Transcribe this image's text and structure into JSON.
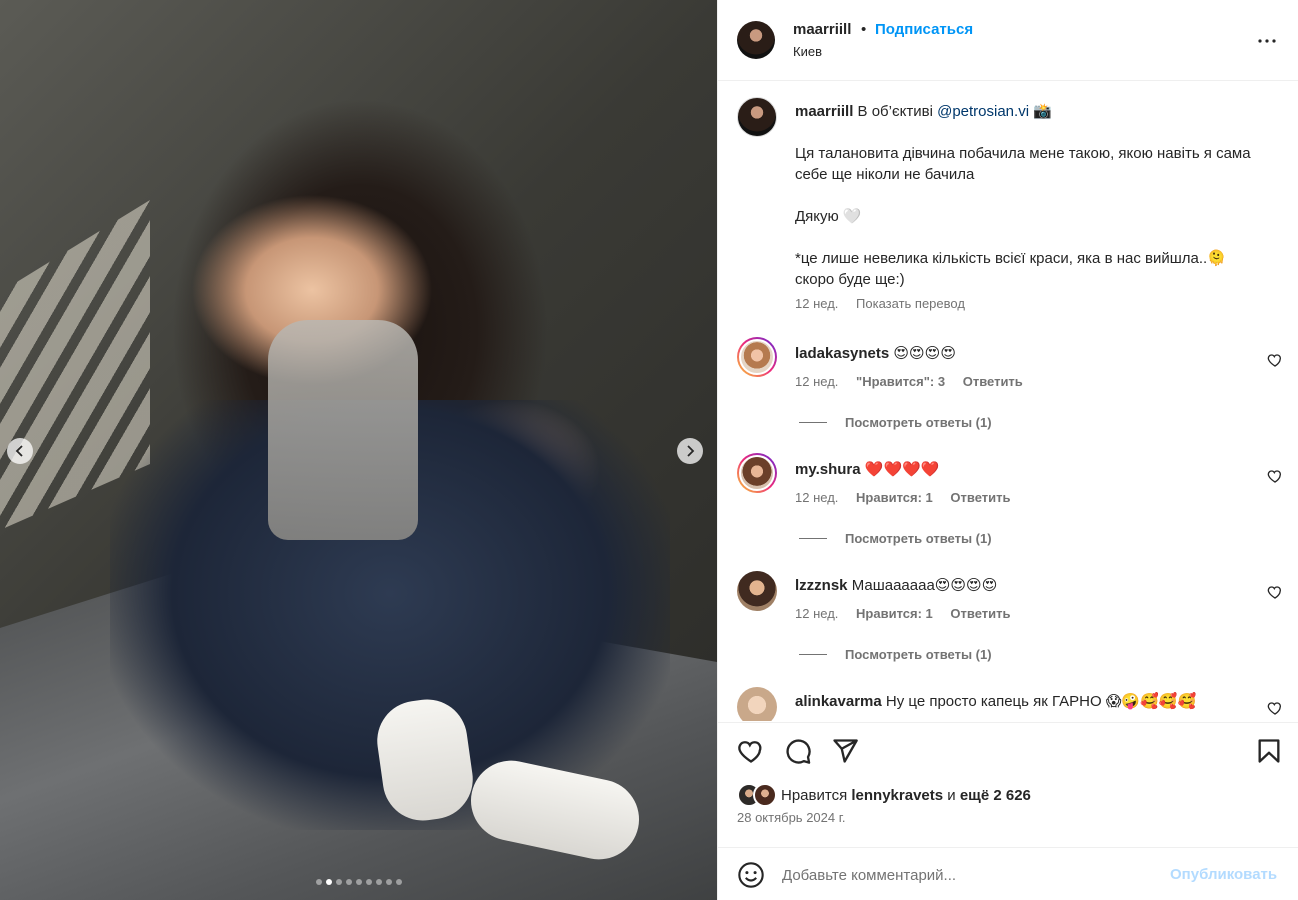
{
  "post": {
    "author": "maarriill",
    "follow_label": "Подписаться",
    "separator": "•",
    "location": "Киев"
  },
  "caption": {
    "author": "maarriill",
    "intro": "В об’єктиві",
    "mention": "@petrosian.vi",
    "camera_emoji": "📸",
    "line1": "Ця талановита дівчина побачила мене такою, якою навіть я сама себе ще ніколи не бачила",
    "line2": "Дякую 🤍",
    "line3": "*це лише невелика кількість всієї краси, яка в нас вийшла..🫠 скоро буде ще:)",
    "age": "12 нед.",
    "translate_label": "Показать перевод"
  },
  "comments": [
    {
      "user": "ladakasynets",
      "text": "😍😍😍😍",
      "age": "12 нед.",
      "likes": "\"Нравится\": 3",
      "reply": "Ответить",
      "view_replies": "Посмотреть ответы (1)"
    },
    {
      "user": "my.shura",
      "text": "❤️❤️❤️❤️",
      "age": "12 нед.",
      "likes": "Нравится: 1",
      "reply": "Ответить",
      "view_replies": "Посмотреть ответы (1)"
    },
    {
      "user": "lzzznsk",
      "text": "Машаааааа😍😍😍😍",
      "age": "12 нед.",
      "likes": "Нравится: 1",
      "reply": "Ответить",
      "view_replies": "Посмотреть ответы (1)"
    },
    {
      "user": "alinkavarma",
      "text": "Ну це просто капець як ГАРНО 😱🤪🥰🥰🥰"
    }
  ],
  "likes": {
    "prefix": "Нравится",
    "user": "lennykravets",
    "and": "и",
    "rest": "ещё 2 626"
  },
  "date": "28 октябрь 2024 г.",
  "composer": {
    "placeholder": "Добавьте комментарий...",
    "publish_label": "Опубликовать"
  },
  "carousel": {
    "slides": 9,
    "current": 2
  },
  "colors": {
    "accent": "#0095f6",
    "publish_disabled": "#b3dbff",
    "secondary_text": "#737373"
  },
  "icons": [
    "more-icon",
    "heart-icon",
    "comment-icon",
    "share-icon",
    "bookmark-icon",
    "emoji-icon",
    "chevron-left-icon",
    "chevron-right-icon"
  ]
}
